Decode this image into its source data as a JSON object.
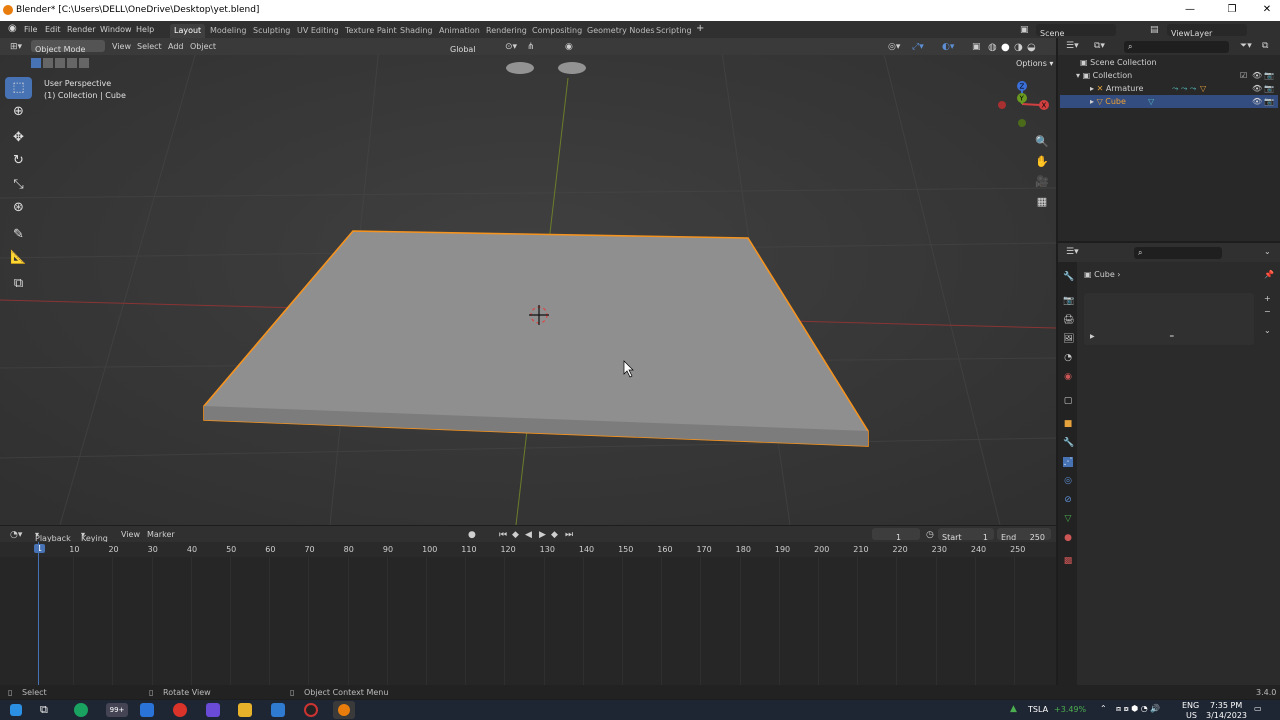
{
  "window": {
    "title": "Blender* [C:\\Users\\DELL\\OneDrive\\Desktop\\yet.blend]",
    "minimize": "—",
    "maximize": "❐",
    "close": "✕"
  },
  "menu": {
    "items": [
      "File",
      "Edit",
      "Render",
      "Window",
      "Help"
    ]
  },
  "workspaces": [
    "Layout",
    "Modeling",
    "Sculpting",
    "UV Editing",
    "Texture Paint",
    "Shading",
    "Animation",
    "Rendering",
    "Compositing",
    "Geometry Nodes",
    "Scripting"
  ],
  "active_workspace": "Layout",
  "add_workspace": "+",
  "scene": {
    "label": "Scene",
    "view_layer": "ViewLayer"
  },
  "viewport_header": {
    "mode": "Object Mode",
    "view": "View",
    "select": "Select",
    "add": "Add",
    "object": "Object",
    "orientation": "Global",
    "options": "Options"
  },
  "viewport_info": {
    "line1": "User Perspective",
    "line2": "(1) Collection | Cube"
  },
  "gizmo": {
    "z": "Z",
    "y": "Y",
    "x": "X"
  },
  "outliner": {
    "scene_collection": "Scene Collection",
    "collection": "Collection",
    "items": [
      "Armature",
      "Cube"
    ]
  },
  "properties": {
    "object_name": "Cube"
  },
  "timeline": {
    "playback": "Playback",
    "keying": "Keying",
    "view": "View",
    "marker": "Marker",
    "current_frame": "1",
    "start_label": "Start",
    "start": "1",
    "end_label": "End",
    "end": "250",
    "ruler": [
      "1",
      "10",
      "20",
      "30",
      "40",
      "50",
      "60",
      "70",
      "80",
      "90",
      "100",
      "110",
      "120",
      "130",
      "140",
      "150",
      "160",
      "170",
      "180",
      "190",
      "200",
      "210",
      "220",
      "230",
      "240",
      "250"
    ]
  },
  "statusbar": {
    "select": "Select",
    "rotate": "Rotate View",
    "context": "Object Context Menu",
    "version": "3.4.0"
  },
  "taskbar": {
    "stock_name": "TSLA",
    "stock_change": "+3.49%",
    "lang": "ENG",
    "region": "US",
    "time": "7:35 PM",
    "date": "3/14/2023",
    "badge": "99+"
  },
  "colors": {
    "accent": "#4772b3",
    "selection": "#f5931f",
    "x_axis": "#c03a3a",
    "y_axis": "#7a9a2a"
  }
}
